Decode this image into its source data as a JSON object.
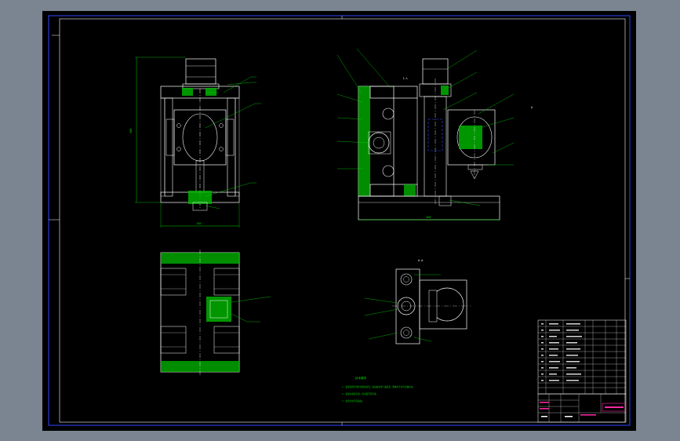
{
  "drawing": {
    "background_color": "#7a8591",
    "sheet_color": "#000000",
    "line_color": "#ffffff",
    "frame_color": "#2f46ff",
    "dim_color": "#00d400",
    "hatch_color": "#00b000",
    "leader_color": "#00d400",
    "title_block_highlight": "#ff2aa6",
    "dimensions": {
      "height_front": "300",
      "width_front": "150",
      "width_side": "300"
    },
    "section_label": "A-A",
    "tech_requirements_heading": "技术要求",
    "tech_requirements": [
      "1. 装配前所有零件用煤油清洗，滚动轴承用汽油清洗，箱体内不许有杂物存在。",
      "2. 装配时各配合面，密封面不得有漆。",
      "3. 各密封处不得漏油。"
    ]
  }
}
